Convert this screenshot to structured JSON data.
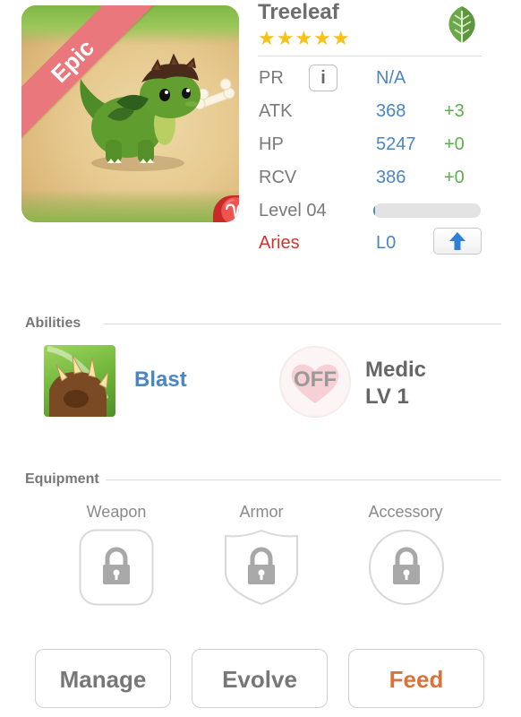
{
  "monster": {
    "rarity": "Epic",
    "name": "Treeleaf",
    "stars": "★★★★★",
    "star_count": 5,
    "element_icon": "leaf-icon",
    "sign_glyph": "♈"
  },
  "stats": {
    "pr": {
      "label": "PR",
      "value": "N/A",
      "info_glyph": "i"
    },
    "atk": {
      "label": "ATK",
      "value": "368",
      "bonus": "+3"
    },
    "hp": {
      "label": "HP",
      "value": "5247",
      "bonus": "+0"
    },
    "rcv": {
      "label": "RCV",
      "value": "386",
      "bonus": "+0"
    },
    "level": {
      "label": "Level 04",
      "xp_fraction": 0.02
    },
    "sign": {
      "label": "Aries",
      "value": "L0"
    }
  },
  "abilities": {
    "title": "Abilities",
    "active": {
      "name": "Blast",
      "icon": "claw-icon"
    },
    "passive": {
      "status": "OFF",
      "name": "Medic",
      "level": "LV 1",
      "icon": "heart-icon"
    }
  },
  "equipment": {
    "title": "Equipment",
    "slots": [
      {
        "label": "Weapon",
        "icon": "lock-icon"
      },
      {
        "label": "Armor",
        "icon": "lock-icon"
      },
      {
        "label": "Accessory",
        "icon": "lock-icon"
      }
    ]
  },
  "buttons": {
    "manage": "Manage",
    "evolve": "Evolve",
    "feed": "Feed"
  },
  "colors": {
    "value_blue": "#4a86c3",
    "bonus_green": "#5ab04e",
    "aries_red": "#d0342c",
    "feed_orange": "#d9733b",
    "star_gold": "#f6c21a",
    "epic_ribbon": "#e9777b"
  }
}
